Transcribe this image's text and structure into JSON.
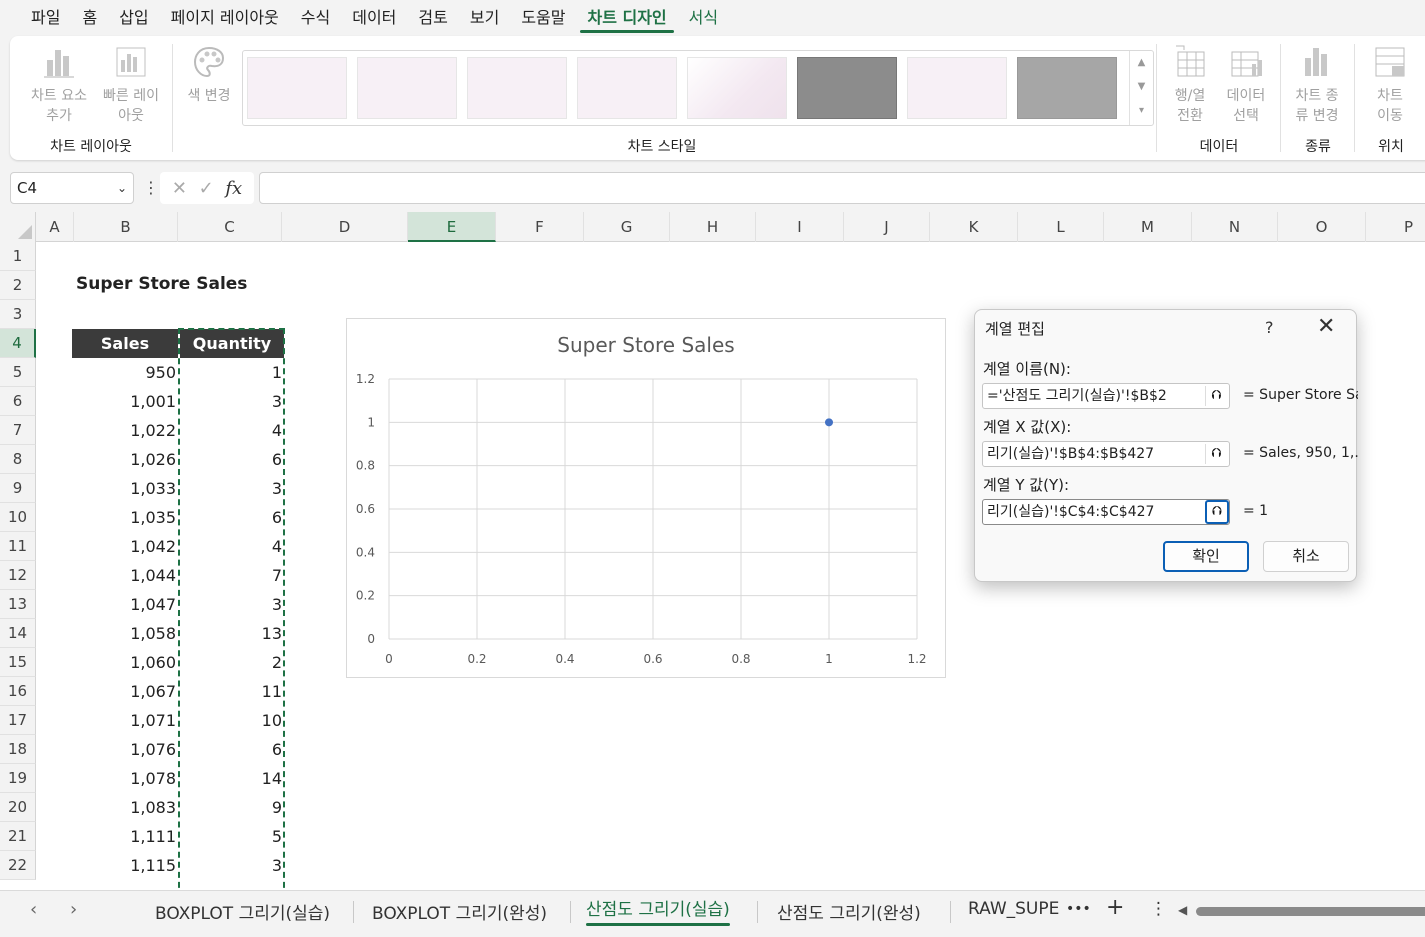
{
  "menu": {
    "tabs": [
      "파일",
      "홈",
      "삽입",
      "페이지 레이아웃",
      "수식",
      "데이터",
      "검토",
      "보기",
      "도움말",
      "차트 디자인",
      "서식"
    ],
    "active": "차트 디자인"
  },
  "ribbon": {
    "add_element_label": "차트 요소 추가",
    "quick_layout_label": "빠른 레이아웃",
    "change_colors_label": "색 변경",
    "layout_group": "차트 레이아웃",
    "styles_group": "차트 스타일",
    "switch_row_col_label": "행/열 전환",
    "select_data_label": "데이터 선택",
    "data_group": "데이터",
    "change_type_label": "차트 종류 변경",
    "type_group": "종류",
    "move_chart_label": "차트 이동",
    "location_group": "위치"
  },
  "formula_bar": {
    "name_box": "C4",
    "fx": "fx",
    "formula": ""
  },
  "columns": [
    "A",
    "B",
    "C",
    "D",
    "E",
    "F",
    "G",
    "H",
    "I",
    "J",
    "K",
    "L",
    "M",
    "N",
    "O",
    "P"
  ],
  "rows": [
    "1",
    "2",
    "3",
    "4",
    "5",
    "6",
    "7",
    "8",
    "9",
    "10",
    "11",
    "12",
    "13",
    "14",
    "15",
    "16",
    "17",
    "18",
    "19",
    "20",
    "21",
    "22"
  ],
  "sheet": {
    "title": "Super Store Sales",
    "headers": [
      "Sales",
      "Quantity"
    ],
    "data": [
      [
        "950",
        "1"
      ],
      [
        "1,001",
        "3"
      ],
      [
        "1,022",
        "4"
      ],
      [
        "1,026",
        "6"
      ],
      [
        "1,033",
        "3"
      ],
      [
        "1,035",
        "6"
      ],
      [
        "1,042",
        "4"
      ],
      [
        "1,044",
        "7"
      ],
      [
        "1,047",
        "3"
      ],
      [
        "1,058",
        "13"
      ],
      [
        "1,060",
        "2"
      ],
      [
        "1,067",
        "11"
      ],
      [
        "1,071",
        "10"
      ],
      [
        "1,076",
        "6"
      ],
      [
        "1,078",
        "14"
      ],
      [
        "1,083",
        "9"
      ],
      [
        "1,111",
        "5"
      ],
      [
        "1,115",
        "3"
      ]
    ]
  },
  "chart_data": {
    "type": "scatter",
    "title": "Super Store Sales",
    "x": [
      1
    ],
    "y": [
      1
    ],
    "xlim": [
      0,
      1.2
    ],
    "ylim": [
      0,
      1.2
    ],
    "xticks": [
      "0",
      "0.2",
      "0.4",
      "0.6",
      "0.8",
      "1",
      "1.2"
    ],
    "yticks": [
      "0",
      "0.2",
      "0.4",
      "0.6",
      "0.8",
      "1",
      "1.2"
    ],
    "grid": true,
    "color": "#4472c4"
  },
  "dialog": {
    "title": "계열 편집",
    "help": "?",
    "close": "✕",
    "name_label": "계열 이름(N):",
    "name_value": "='산점도 그리기(실습)'!$B$2",
    "name_result": "= Super Store Sales",
    "x_label": "계열 X 값(X):",
    "x_value": "리기(실습)'!$B$4:$B$427",
    "x_result": "= Sales, 950, 1,...",
    "y_label": "계열 Y 값(Y):",
    "y_value": "리기(실습)'!$C$4:$C$427",
    "y_result": "= 1",
    "ok": "확인",
    "cancel": "취소"
  },
  "sheet_tabs": {
    "tabs": [
      "BOXPLOT 그리기(실습)",
      "BOXPLOT 그리기(완성)",
      "산점도 그리기(실습)",
      "산점도 그리기(완성)",
      "RAW_SUPE"
    ],
    "active": "산점도 그리기(실습)",
    "more": "•••",
    "add": "+",
    "options": "⋮"
  },
  "colors": {
    "accent": "#1e7145",
    "header_fill": "#3b3b3b",
    "point": "#4472c4"
  }
}
